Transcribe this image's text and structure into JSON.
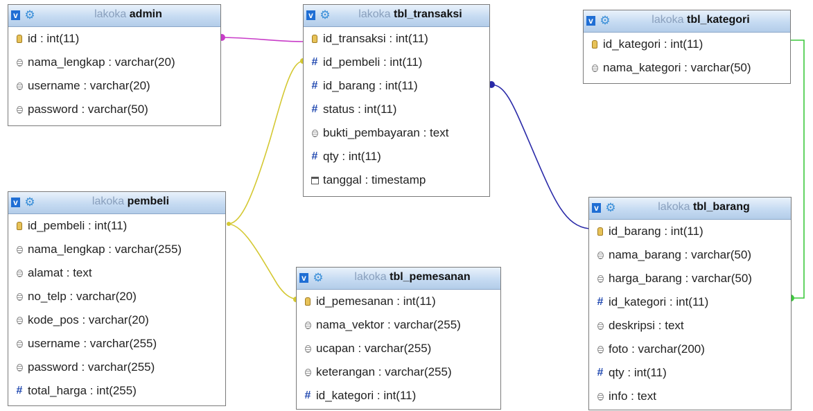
{
  "tables": {
    "admin": {
      "db": "lakoka",
      "name": "admin",
      "columns": [
        {
          "icon": "key",
          "text": "id : int(11)"
        },
        {
          "icon": "text",
          "text": "nama_lengkap : varchar(20)"
        },
        {
          "icon": "text",
          "text": "username : varchar(20)"
        },
        {
          "icon": "text",
          "text": "password : varchar(50)"
        }
      ]
    },
    "pembeli": {
      "db": "lakoka",
      "name": "pembeli",
      "columns": [
        {
          "icon": "key",
          "text": "id_pembeli : int(11)"
        },
        {
          "icon": "text",
          "text": "nama_lengkap : varchar(255)"
        },
        {
          "icon": "text",
          "text": "alamat : text"
        },
        {
          "icon": "text",
          "text": "no_telp : varchar(20)"
        },
        {
          "icon": "text",
          "text": "kode_pos : varchar(20)"
        },
        {
          "icon": "text",
          "text": "username : varchar(255)"
        },
        {
          "icon": "text",
          "text": "password : varchar(255)"
        },
        {
          "icon": "num",
          "text": "total_harga : int(255)"
        }
      ]
    },
    "tbl_transaksi": {
      "db": "lakoka",
      "name": "tbl_transaksi",
      "columns": [
        {
          "icon": "key",
          "text": "id_transaksi : int(11)"
        },
        {
          "icon": "num",
          "text": "id_pembeli : int(11)"
        },
        {
          "icon": "num",
          "text": "id_barang : int(11)"
        },
        {
          "icon": "num",
          "text": "status : int(11)"
        },
        {
          "icon": "text",
          "text": "bukti_pembayaran : text"
        },
        {
          "icon": "num",
          "text": "qty : int(11)"
        },
        {
          "icon": "date",
          "text": "tanggal : timestamp"
        }
      ]
    },
    "tbl_pemesanan": {
      "db": "lakoka",
      "name": "tbl_pemesanan",
      "columns": [
        {
          "icon": "key",
          "text": "id_pemesanan : int(11)"
        },
        {
          "icon": "text",
          "text": "nama_vektor : varchar(255)"
        },
        {
          "icon": "text",
          "text": "ucapan : varchar(255)"
        },
        {
          "icon": "text",
          "text": "keterangan : varchar(255)"
        },
        {
          "icon": "num",
          "text": "id_kategori : int(11)"
        }
      ]
    },
    "tbl_kategori": {
      "db": "lakoka",
      "name": "tbl_kategori",
      "columns": [
        {
          "icon": "key",
          "text": "id_kategori : int(11)"
        },
        {
          "icon": "text",
          "text": "nama_kategori : varchar(50)"
        }
      ]
    },
    "tbl_barang": {
      "db": "lakoka",
      "name": "tbl_barang",
      "columns": [
        {
          "icon": "key",
          "text": "id_barang : int(11)"
        },
        {
          "icon": "text",
          "text": "nama_barang : varchar(50)"
        },
        {
          "icon": "text",
          "text": "harga_barang : varchar(50)"
        },
        {
          "icon": "num",
          "text": "id_kategori : int(11)"
        },
        {
          "icon": "text",
          "text": "deskripsi : text"
        },
        {
          "icon": "text",
          "text": "foto : varchar(200)"
        },
        {
          "icon": "num",
          "text": "qty : int(11)"
        },
        {
          "icon": "text",
          "text": "info : text"
        }
      ]
    }
  },
  "header_toggle": "v",
  "relation_colors": {
    "admin_transaksi": "#c83cc8",
    "pembeli_links": "#d4c832",
    "transaksi_barang": "#2a2aa8",
    "kategori_barang": "#3cc83c"
  },
  "icons": {
    "toggle": "v-toggle-icon",
    "options": "gear-icon",
    "key": "primary-key-icon",
    "text": "text-column-icon",
    "num": "numeric-column-icon",
    "date": "timestamp-column-icon"
  }
}
